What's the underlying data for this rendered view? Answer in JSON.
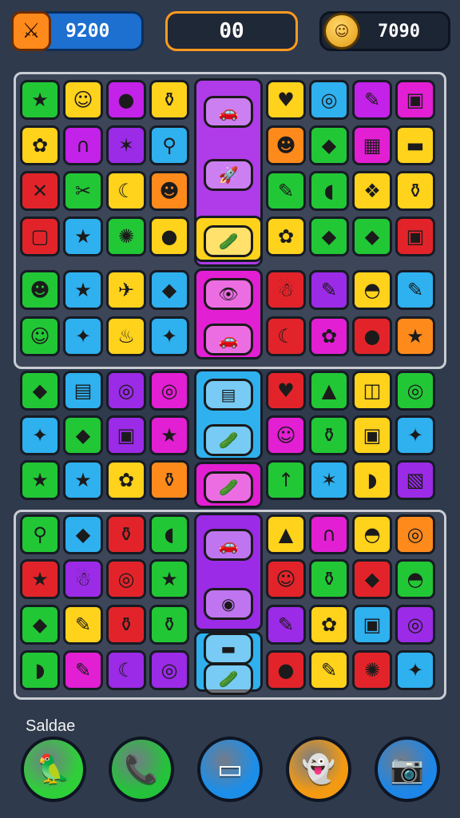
{
  "hud": {
    "score_value": "9200",
    "score_icon": "sword-icon",
    "moves_value": "00",
    "coins_value": "7090",
    "coin_icon": "coin-face-icon"
  },
  "footer": {
    "label": "Saldae",
    "buttons": [
      {
        "name": "green-bird-button",
        "glyph": "🦜",
        "color": "#2fcf3a"
      },
      {
        "name": "phone-button",
        "glyph": "📞",
        "color": "#25c23b"
      },
      {
        "name": "box-button",
        "glyph": "▭",
        "color": "#1d8ee8"
      },
      {
        "name": "ghost-button",
        "glyph": "👻",
        "color": "#f39a12"
      },
      {
        "name": "camera-button",
        "glyph": "📷",
        "color": "#1d86e6"
      }
    ]
  },
  "colors": {
    "bg": "#2f3a4d",
    "accent_orange": "#ff9a1f",
    "tile_green": "#22c736",
    "tile_yellow": "#ffd21c",
    "tile_purple": "#8a2be2",
    "tile_magenta": "#e21fd3",
    "tile_red": "#e2242a",
    "tile_blue": "#2fb0ef",
    "tile_orange": "#ff8a1c"
  },
  "board": {
    "tiles": [
      {
        "c": "#22c736",
        "g": "★"
      },
      {
        "c": "#ffd21c",
        "g": "☺"
      },
      {
        "c": "#c322e8",
        "g": "●"
      },
      {
        "c": "#ffd21c",
        "g": "⚱"
      },
      {
        "c": "#ffd21c",
        "g": "♥"
      },
      {
        "c": "#2fb0ef",
        "g": "◎"
      },
      {
        "c": "#c322e8",
        "g": "✎"
      },
      {
        "c": "#e21fd3",
        "g": "▣"
      },
      {
        "c": "#ffd21c",
        "g": "✿"
      },
      {
        "c": "#c322e8",
        "g": "∩"
      },
      {
        "c": "#9b2be6",
        "g": "✶"
      },
      {
        "c": "#2fb0ef",
        "g": "⚲"
      },
      {
        "c": "#ff8a1c",
        "g": "☻"
      },
      {
        "c": "#22c736",
        "g": "◆"
      },
      {
        "c": "#e21fd3",
        "g": "▦"
      },
      {
        "c": "#ffd21c",
        "g": "▬"
      },
      {
        "c": "#e2242a",
        "g": "✕"
      },
      {
        "c": "#22c736",
        "g": "✂"
      },
      {
        "c": "#ffd21c",
        "g": "☾"
      },
      {
        "c": "#ff8a1c",
        "g": "☻"
      },
      {
        "c": "#22c736",
        "g": "✎"
      },
      {
        "c": "#22c736",
        "g": "◖"
      },
      {
        "c": "#ffd21c",
        "g": "❖"
      },
      {
        "c": "#ffd21c",
        "g": "⚱"
      },
      {
        "c": "#e2242a",
        "g": "▢"
      },
      {
        "c": "#2fb0ef",
        "g": "★"
      },
      {
        "c": "#22c736",
        "g": "✺"
      },
      {
        "c": "#ffd21c",
        "g": "●"
      },
      {
        "c": "#ffd21c",
        "g": "✿"
      },
      {
        "c": "#22c736",
        "g": "◆"
      },
      {
        "c": "#22c736",
        "g": "◆"
      },
      {
        "c": "#e2242a",
        "g": "▣"
      },
      {
        "c": "#22c736",
        "g": "☻"
      },
      {
        "c": "#2fb0ef",
        "g": "★"
      },
      {
        "c": "#ffd21c",
        "g": "✈"
      },
      {
        "c": "#2fb0ef",
        "g": "◆"
      },
      {
        "c": "#e2242a",
        "g": "☃"
      },
      {
        "c": "#9b2be6",
        "g": "✎"
      },
      {
        "c": "#ffd21c",
        "g": "◓"
      },
      {
        "c": "#2fb0ef",
        "g": "✎"
      },
      {
        "c": "#22c736",
        "g": "☺"
      },
      {
        "c": "#2fb0ef",
        "g": "✦"
      },
      {
        "c": "#ffd21c",
        "g": "♨"
      },
      {
        "c": "#2fb0ef",
        "g": "✦"
      },
      {
        "c": "#e2242a",
        "g": "☾"
      },
      {
        "c": "#e21fd3",
        "g": "✿"
      },
      {
        "c": "#e2242a",
        "g": "●"
      },
      {
        "c": "#ff8a1c",
        "g": "★"
      },
      {
        "c": "#22c736",
        "g": "◆"
      },
      {
        "c": "#2fb0ef",
        "g": "▤"
      },
      {
        "c": "#9b2be6",
        "g": "◎"
      },
      {
        "c": "#e21fd3",
        "g": "◎"
      },
      {
        "c": "#e2242a",
        "g": "♥"
      },
      {
        "c": "#22c736",
        "g": "▲"
      },
      {
        "c": "#ffd21c",
        "g": "◫"
      },
      {
        "c": "#22c736",
        "g": "◎"
      },
      {
        "c": "#2fb0ef",
        "g": "✦"
      },
      {
        "c": "#22c736",
        "g": "◆"
      },
      {
        "c": "#9b2be6",
        "g": "▣"
      },
      {
        "c": "#e21fd3",
        "g": "★"
      },
      {
        "c": "#e21fd3",
        "g": "☺"
      },
      {
        "c": "#22c736",
        "g": "⚱"
      },
      {
        "c": "#ffd21c",
        "g": "▣"
      },
      {
        "c": "#2fb0ef",
        "g": "✦"
      },
      {
        "c": "#22c736",
        "g": "★"
      },
      {
        "c": "#2fb0ef",
        "g": "★"
      },
      {
        "c": "#ffd21c",
        "g": "✿"
      },
      {
        "c": "#ff8a1c",
        "g": "⚱"
      },
      {
        "c": "#22c736",
        "g": "↑"
      },
      {
        "c": "#2fb0ef",
        "g": "✶"
      },
      {
        "c": "#ffd21c",
        "g": "◗"
      },
      {
        "c": "#9b2be6",
        "g": "▧"
      },
      {
        "c": "#22c736",
        "g": "⚲"
      },
      {
        "c": "#2fb0ef",
        "g": "◆"
      },
      {
        "c": "#e2242a",
        "g": "⚱"
      },
      {
        "c": "#22c736",
        "g": "◖"
      },
      {
        "c": "#ffd21c",
        "g": "▲"
      },
      {
        "c": "#e21fd3",
        "g": "∩"
      },
      {
        "c": "#ffd21c",
        "g": "◓"
      },
      {
        "c": "#ff8a1c",
        "g": "◎"
      },
      {
        "c": "#e2242a",
        "g": "★"
      },
      {
        "c": "#9b2be6",
        "g": "☃"
      },
      {
        "c": "#e2242a",
        "g": "◎"
      },
      {
        "c": "#22c736",
        "g": "★"
      },
      {
        "c": "#e2242a",
        "g": "☺"
      },
      {
        "c": "#22c736",
        "g": "⚱"
      },
      {
        "c": "#e2242a",
        "g": "◆"
      },
      {
        "c": "#22c736",
        "g": "◓"
      },
      {
        "c": "#22c736",
        "g": "◆"
      },
      {
        "c": "#ffd21c",
        "g": "✎"
      },
      {
        "c": "#e2242a",
        "g": "⚱"
      },
      {
        "c": "#22c736",
        "g": "⚱"
      },
      {
        "c": "#9b2be6",
        "g": "✎"
      },
      {
        "c": "#ffd21c",
        "g": "✿"
      },
      {
        "c": "#2fb0ef",
        "g": "▣"
      },
      {
        "c": "#9b2be6",
        "g": "◎"
      },
      {
        "c": "#22c736",
        "g": "◗"
      },
      {
        "c": "#e21fd3",
        "g": "✎"
      },
      {
        "c": "#9b2be6",
        "g": "☾"
      },
      {
        "c": "#9b2be6",
        "g": "◎"
      },
      {
        "c": "#e2242a",
        "g": "●"
      },
      {
        "c": "#ffd21c",
        "g": "✎"
      },
      {
        "c": "#e2242a",
        "g": "✺"
      },
      {
        "c": "#2fb0ef",
        "g": "✦"
      }
    ],
    "long_pieces": [
      {
        "c": "#b03be8",
        "icons": [
          "🚗",
          "🚀",
          "🪐"
        ]
      },
      {
        "c": "#ffd21c",
        "icons": [
          "🥒"
        ]
      },
      {
        "c": "#e21fd3",
        "icons": [
          "👁",
          "🚗"
        ]
      },
      {
        "c": "#2fb0ef",
        "icons": [
          "▤",
          "🥒"
        ]
      },
      {
        "c": "#e21fd3",
        "icons": [
          "🥒"
        ]
      },
      {
        "c": "#9b2be6",
        "icons": [
          "🚗",
          "◉"
        ]
      },
      {
        "c": "#2fb0ef",
        "icons": [
          "▬",
          "🥒"
        ]
      }
    ]
  }
}
